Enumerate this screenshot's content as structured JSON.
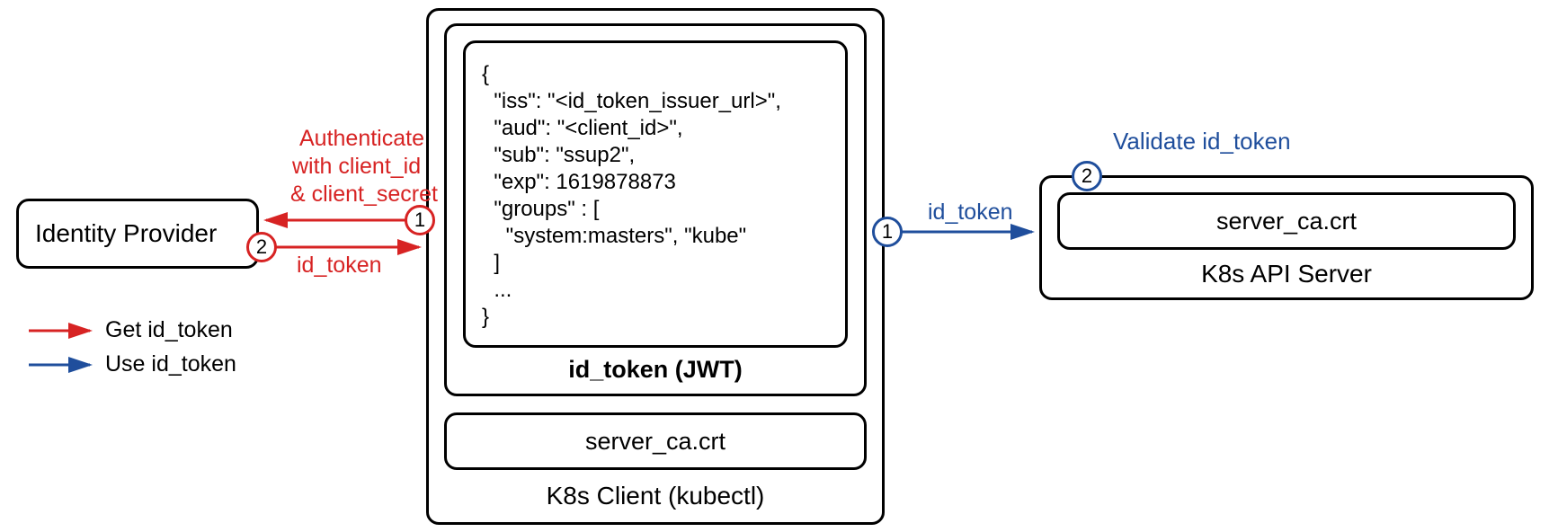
{
  "identity_provider": {
    "title": "Identity Provider"
  },
  "k8s_client": {
    "title": "K8s Client (kubectl)",
    "id_token_label": "id_token (JWT)",
    "server_ca": "server_ca.crt",
    "jwt": "{\n  \"iss\": \"<id_token_issuer_url>\",\n  \"aud\": \"<client_id>\",\n  \"sub\": \"ssup2\",\n  \"exp\": 1619878873\n  \"groups\" : [\n    \"system:masters\", \"kube\"\n  ]\n  ...\n}"
  },
  "k8s_api_server": {
    "title": "K8s API Server",
    "server_ca": "server_ca.crt",
    "validate_label": "Validate id_token"
  },
  "flow_red": {
    "auth_label_l1": "Authenticate",
    "auth_label_l2": "with client_id",
    "auth_label_l3": "& client_secret",
    "id_token_label": "id_token",
    "step1": "1",
    "step2": "2"
  },
  "flow_blue": {
    "id_token_label": "id_token",
    "step1": "1",
    "step2": "2"
  },
  "legend": {
    "get": "Get id_token",
    "use": "Use id_token"
  }
}
